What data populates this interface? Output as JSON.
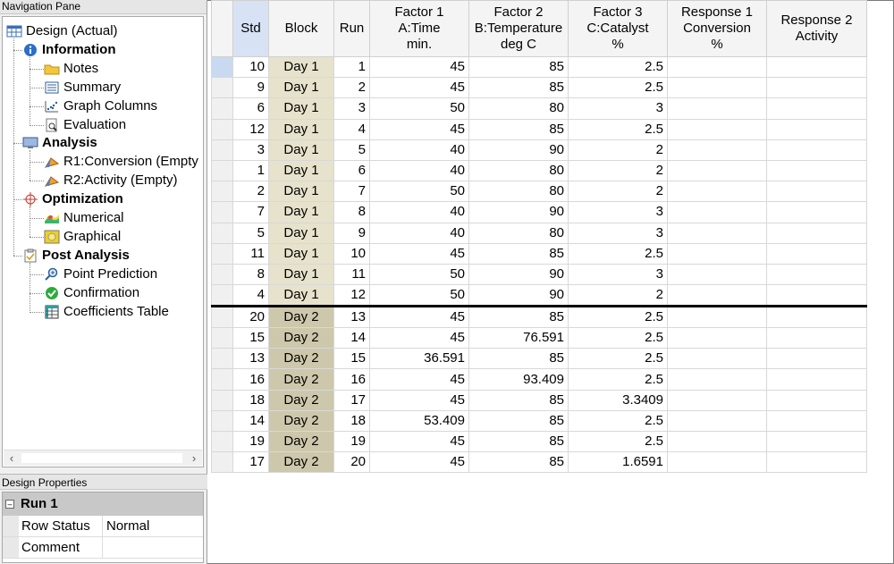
{
  "nav_pane": {
    "title": "Navigation Pane",
    "items": [
      {
        "label": "Design (Actual)",
        "icon": "table-icon",
        "level": 0,
        "bold": false
      },
      {
        "label": "Information",
        "icon": "info-icon",
        "level": 1,
        "bold": true
      },
      {
        "label": "Notes",
        "icon": "folder-icon",
        "level": 2,
        "bold": false
      },
      {
        "label": "Summary",
        "icon": "summary-icon",
        "level": 2,
        "bold": false
      },
      {
        "label": "Graph Columns",
        "icon": "scatter-plot-icon",
        "level": 2,
        "bold": false
      },
      {
        "label": "Evaluation",
        "icon": "evaluation-icon",
        "level": 2,
        "bold": false
      },
      {
        "label": "Analysis",
        "icon": "monitor-icon",
        "level": 1,
        "bold": true
      },
      {
        "label": "R1:Conversion (Empty",
        "icon": "response-icon",
        "level": 2,
        "bold": false
      },
      {
        "label": "R2:Activity (Empty)",
        "icon": "response-icon",
        "level": 2,
        "bold": false
      },
      {
        "label": "Optimization",
        "icon": "crosshair-icon",
        "level": 1,
        "bold": true
      },
      {
        "label": "Numerical",
        "icon": "surface-icon",
        "level": 2,
        "bold": false
      },
      {
        "label": "Graphical",
        "icon": "graphical-icon",
        "level": 2,
        "bold": false
      },
      {
        "label": "Post Analysis",
        "icon": "clipboard-icon",
        "level": 1,
        "bold": true
      },
      {
        "label": "Point Prediction",
        "icon": "magnifier-icon",
        "level": 2,
        "bold": false
      },
      {
        "label": "Confirmation",
        "icon": "check-icon",
        "level": 2,
        "bold": false
      },
      {
        "label": "Coefficients Table",
        "icon": "coefficients-table-icon",
        "level": 2,
        "bold": false
      }
    ]
  },
  "design_properties": {
    "title": "Design Properties",
    "category": "Run 1",
    "rows": [
      {
        "key": "Row Status",
        "value": "Normal"
      },
      {
        "key": "Comment",
        "value": ""
      }
    ]
  },
  "grid": {
    "columns": [
      {
        "lines": [
          "Std"
        ]
      },
      {
        "lines": [
          "Block"
        ]
      },
      {
        "lines": [
          "Run"
        ]
      },
      {
        "lines": [
          "Factor 1",
          "A:Time",
          "min."
        ]
      },
      {
        "lines": [
          "Factor 2",
          "B:Temperature",
          "deg C"
        ]
      },
      {
        "lines": [
          "Factor 3",
          "C:Catalyst",
          "%"
        ]
      },
      {
        "lines": [
          "Response 1",
          "Conversion",
          "%"
        ]
      },
      {
        "lines": [
          "Response 2",
          "Activity"
        ]
      }
    ],
    "rows": [
      {
        "std": "10",
        "block": "Day 1",
        "run": "1",
        "a": "45",
        "b": "85",
        "c": "2.5",
        "r1": "",
        "r2": ""
      },
      {
        "std": "9",
        "block": "Day 1",
        "run": "2",
        "a": "45",
        "b": "85",
        "c": "2.5",
        "r1": "",
        "r2": ""
      },
      {
        "std": "6",
        "block": "Day 1",
        "run": "3",
        "a": "50",
        "b": "80",
        "c": "3",
        "r1": "",
        "r2": ""
      },
      {
        "std": "12",
        "block": "Day 1",
        "run": "4",
        "a": "45",
        "b": "85",
        "c": "2.5",
        "r1": "",
        "r2": ""
      },
      {
        "std": "3",
        "block": "Day 1",
        "run": "5",
        "a": "40",
        "b": "90",
        "c": "2",
        "r1": "",
        "r2": ""
      },
      {
        "std": "1",
        "block": "Day 1",
        "run": "6",
        "a": "40",
        "b": "80",
        "c": "2",
        "r1": "",
        "r2": ""
      },
      {
        "std": "2",
        "block": "Day 1",
        "run": "7",
        "a": "50",
        "b": "80",
        "c": "2",
        "r1": "",
        "r2": ""
      },
      {
        "std": "7",
        "block": "Day 1",
        "run": "8",
        "a": "40",
        "b": "90",
        "c": "3",
        "r1": "",
        "r2": ""
      },
      {
        "std": "5",
        "block": "Day 1",
        "run": "9",
        "a": "40",
        "b": "80",
        "c": "3",
        "r1": "",
        "r2": ""
      },
      {
        "std": "11",
        "block": "Day 1",
        "run": "10",
        "a": "45",
        "b": "85",
        "c": "2.5",
        "r1": "",
        "r2": ""
      },
      {
        "std": "8",
        "block": "Day 1",
        "run": "11",
        "a": "50",
        "b": "90",
        "c": "3",
        "r1": "",
        "r2": ""
      },
      {
        "std": "4",
        "block": "Day 1",
        "run": "12",
        "a": "50",
        "b": "90",
        "c": "2",
        "r1": "",
        "r2": ""
      },
      {
        "std": "20",
        "block": "Day 2",
        "run": "13",
        "a": "45",
        "b": "85",
        "c": "2.5",
        "r1": "",
        "r2": ""
      },
      {
        "std": "15",
        "block": "Day 2",
        "run": "14",
        "a": "45",
        "b": "76.591",
        "c": "2.5",
        "r1": "",
        "r2": ""
      },
      {
        "std": "13",
        "block": "Day 2",
        "run": "15",
        "a": "36.591",
        "b": "85",
        "c": "2.5",
        "r1": "",
        "r2": ""
      },
      {
        "std": "16",
        "block": "Day 2",
        "run": "16",
        "a": "45",
        "b": "93.409",
        "c": "2.5",
        "r1": "",
        "r2": ""
      },
      {
        "std": "18",
        "block": "Day 2",
        "run": "17",
        "a": "45",
        "b": "85",
        "c": "3.3409",
        "r1": "",
        "r2": ""
      },
      {
        "std": "14",
        "block": "Day 2",
        "run": "18",
        "a": "53.409",
        "b": "85",
        "c": "2.5",
        "r1": "",
        "r2": ""
      },
      {
        "std": "19",
        "block": "Day 2",
        "run": "19",
        "a": "45",
        "b": "85",
        "c": "2.5",
        "r1": "",
        "r2": ""
      },
      {
        "std": "17",
        "block": "Day 2",
        "run": "20",
        "a": "45",
        "b": "85",
        "c": "1.6591",
        "r1": "",
        "r2": ""
      }
    ]
  },
  "colors": {
    "block_day1": "#e6e2cb",
    "block_day2": "#cdc8ab",
    "std_header": "#d7e3f4",
    "selected_row_marker": "#c9d9f0"
  }
}
